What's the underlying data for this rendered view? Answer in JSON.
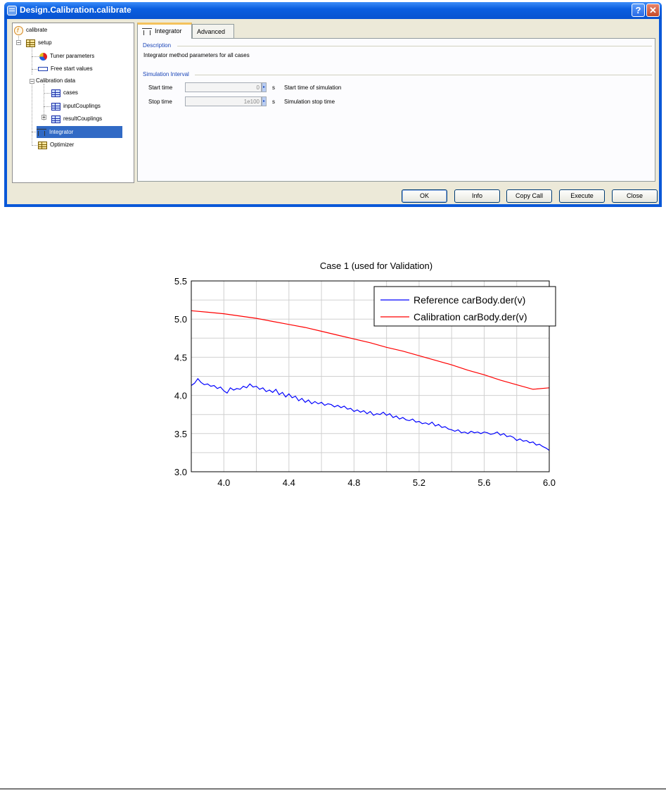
{
  "window": {
    "title": "Design.Calibration.calibrate",
    "help_glyph": "?",
    "close_glyph": "✕"
  },
  "tree": {
    "root": "calibrate",
    "setup": "setup",
    "tuner": "Tuner parameters",
    "free_start": "Free start values",
    "calibration_data": "Calibration data",
    "cases": "cases",
    "input_couplings": "inputCouplings",
    "result_couplings": "resultCouplings",
    "integrator": "Integrator",
    "optimizer": "Optimizer",
    "expander_minus": "−",
    "expander_plus": "+"
  },
  "tabs": {
    "integrator": "Integrator",
    "advanced": "Advanced"
  },
  "panel": {
    "description_heading": "Description",
    "description_text": "Integrator method parameters for all cases",
    "interval_heading": "Simulation Interval",
    "start_label": "Start time",
    "start_value": "0",
    "start_unit": "s",
    "start_desc": "Start time of simulation",
    "stop_label": "Stop time",
    "stop_value": "1e100",
    "stop_unit": "s",
    "stop_desc": "Simulation stop time",
    "arrow_glyph": "▸"
  },
  "buttons": {
    "ok": "OK",
    "info": "Info",
    "copy_call": "Copy Call",
    "execute": "Execute",
    "close": "Close"
  },
  "chart_data": {
    "type": "line",
    "title": "Case 1 (used for Validation)",
    "xlim": [
      3.8,
      6.0
    ],
    "ylim": [
      3.0,
      5.5
    ],
    "xticks": [
      "4.0",
      "4.4",
      "4.8",
      "5.2",
      "5.6",
      "6.0"
    ],
    "xtick_values": [
      4.0,
      4.4,
      4.8,
      5.2,
      5.6,
      6.0
    ],
    "yticks": [
      "3.0",
      "3.5",
      "4.0",
      "4.5",
      "5.0",
      "5.5"
    ],
    "ytick_values": [
      3.0,
      3.5,
      4.0,
      4.5,
      5.0,
      5.5
    ],
    "grid": true,
    "legend_position": "top-right",
    "series": [
      {
        "name": "Reference carBody.der(v)",
        "color": "#0000ff",
        "x": [
          3.8,
          3.82,
          3.84,
          3.86,
          3.88,
          3.9,
          3.92,
          3.94,
          3.96,
          3.98,
          4.0,
          4.02,
          4.04,
          4.06,
          4.08,
          4.1,
          4.12,
          4.14,
          4.16,
          4.18,
          4.2,
          4.22,
          4.24,
          4.26,
          4.28,
          4.3,
          4.32,
          4.34,
          4.36,
          4.38,
          4.4,
          4.42,
          4.44,
          4.46,
          4.48,
          4.5,
          4.52,
          4.54,
          4.56,
          4.58,
          4.6,
          4.62,
          4.64,
          4.66,
          4.68,
          4.7,
          4.72,
          4.74,
          4.76,
          4.78,
          4.8,
          4.82,
          4.84,
          4.86,
          4.88,
          4.9,
          4.92,
          4.94,
          4.96,
          4.98,
          5.0,
          5.02,
          5.04,
          5.06,
          5.08,
          5.1,
          5.12,
          5.14,
          5.16,
          5.18,
          5.2,
          5.22,
          5.24,
          5.26,
          5.28,
          5.3,
          5.32,
          5.34,
          5.36,
          5.38,
          5.4,
          5.42,
          5.44,
          5.46,
          5.48,
          5.5,
          5.52,
          5.54,
          5.56,
          5.58,
          5.6,
          5.62,
          5.64,
          5.66,
          5.68,
          5.7,
          5.72,
          5.74,
          5.76,
          5.78,
          5.8,
          5.82,
          5.84,
          5.86,
          5.88,
          5.9,
          5.92,
          5.94,
          5.96,
          5.98,
          6.0
        ],
        "y": [
          4.13,
          4.16,
          4.22,
          4.17,
          4.14,
          4.15,
          4.12,
          4.13,
          4.09,
          4.11,
          4.06,
          4.03,
          4.1,
          4.07,
          4.09,
          4.08,
          4.12,
          4.1,
          4.15,
          4.11,
          4.12,
          4.08,
          4.1,
          4.05,
          4.07,
          4.04,
          4.08,
          4.01,
          4.04,
          3.98,
          4.02,
          3.97,
          3.99,
          3.93,
          3.96,
          3.91,
          3.94,
          3.89,
          3.92,
          3.89,
          3.91,
          3.87,
          3.89,
          3.88,
          3.85,
          3.87,
          3.84,
          3.86,
          3.82,
          3.83,
          3.79,
          3.81,
          3.78,
          3.8,
          3.76,
          3.79,
          3.74,
          3.76,
          3.75,
          3.78,
          3.74,
          3.76,
          3.71,
          3.73,
          3.69,
          3.71,
          3.68,
          3.67,
          3.69,
          3.65,
          3.66,
          3.63,
          3.64,
          3.62,
          3.65,
          3.6,
          3.62,
          3.58,
          3.59,
          3.56,
          3.55,
          3.53,
          3.55,
          3.51,
          3.52,
          3.5,
          3.53,
          3.51,
          3.52,
          3.5,
          3.52,
          3.51,
          3.49,
          3.5,
          3.52,
          3.48,
          3.5,
          3.46,
          3.47,
          3.45,
          3.41,
          3.43,
          3.4,
          3.41,
          3.38,
          3.39,
          3.35,
          3.36,
          3.33,
          3.31,
          3.28
        ]
      },
      {
        "name": "Calibration carBody.der(v)",
        "color": "#ff0000",
        "x": [
          3.8,
          3.9,
          4.0,
          4.1,
          4.2,
          4.3,
          4.4,
          4.5,
          4.6,
          4.7,
          4.8,
          4.9,
          5.0,
          5.1,
          5.2,
          5.3,
          5.4,
          5.5,
          5.6,
          5.7,
          5.8,
          5.9,
          6.0
        ],
        "y": [
          5.11,
          5.09,
          5.07,
          5.04,
          5.01,
          4.97,
          4.93,
          4.89,
          4.84,
          4.79,
          4.74,
          4.69,
          4.63,
          4.58,
          4.52,
          4.46,
          4.4,
          4.33,
          4.27,
          4.2,
          4.14,
          4.08,
          4.1
        ]
      }
    ]
  }
}
